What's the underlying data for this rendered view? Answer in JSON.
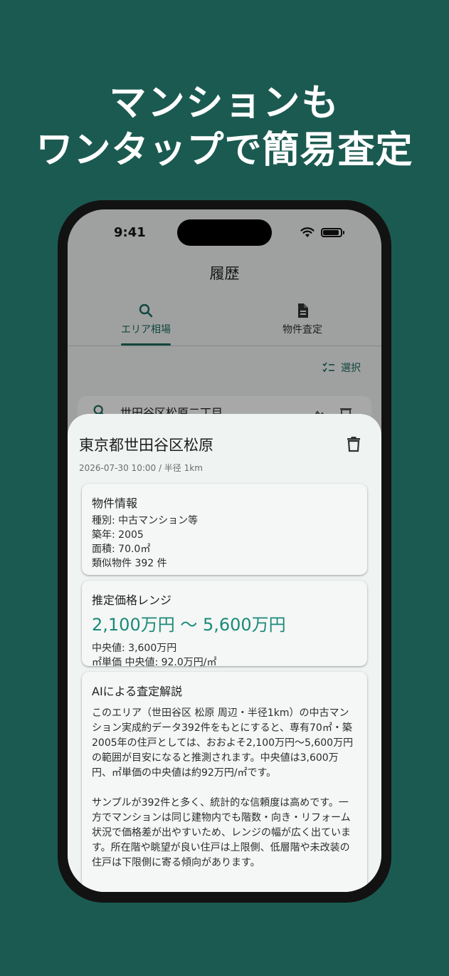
{
  "headline": {
    "line1": "マンションも",
    "line2": "ワンタップで簡易査定"
  },
  "status_bar": {
    "time": "9:41"
  },
  "app_bar": {
    "title": "履歴"
  },
  "tabs": [
    {
      "label": "エリア相場",
      "icon": "search-icon",
      "active": true
    },
    {
      "label": "物件査定",
      "icon": "document-icon",
      "active": false
    }
  ],
  "toolbar": {
    "select_label": "選択"
  },
  "history": {
    "item_label": "世田谷区松原二丁目"
  },
  "sheet": {
    "title": "東京都世田谷区松原",
    "meta": "2026-07-30 10:00 / 半径 1km",
    "property_card": {
      "heading": "物件情報",
      "type": "種別: 中古マンション等",
      "built": "築年: 2005",
      "area": "面積: 70.0㎡",
      "similar": "類似物件 392 件"
    },
    "price_card": {
      "heading": "推定価格レンジ",
      "range": "2,100万円 〜 5,600万円",
      "median": "中央値: 3,600万円",
      "unit_median": "㎡単価 中央値: 92.0万円/㎡"
    },
    "ai_card": {
      "heading": "AIによる査定解説",
      "para1_l1": "このエリア（世田谷区 松原 周辺・半径1km）の中古マン",
      "para1_l2": "ション実成約データ392件をもとにすると、専有70㎡・築",
      "para1_l3": "2005年の住戸としては、おおよそ2,100万円〜5,600万円",
      "para1_l4": "の範囲が目安になると推測されます。中央値は3,600万",
      "para1_l5": "円、㎡単価の中央値は約92万円/㎡です。",
      "para2_l1": "サンプルが392件と多く、統計的な信頼度は高めです。一",
      "para2_l2": "方でマンションは同じ建物内でも階数・向き・リフォーム",
      "para2_l3": "状況で価格差が出やすいため、レンジの幅が広く出ていま",
      "para2_l4": "す。所在階や眺望が良い住戸は上限側、低層階や未改装の",
      "para2_l5": "住戸は下限側に寄る傾向があります。"
    }
  },
  "colors": {
    "background": "#1b5a51",
    "accent": "#1e6b60",
    "price": "#1b8a7a"
  }
}
